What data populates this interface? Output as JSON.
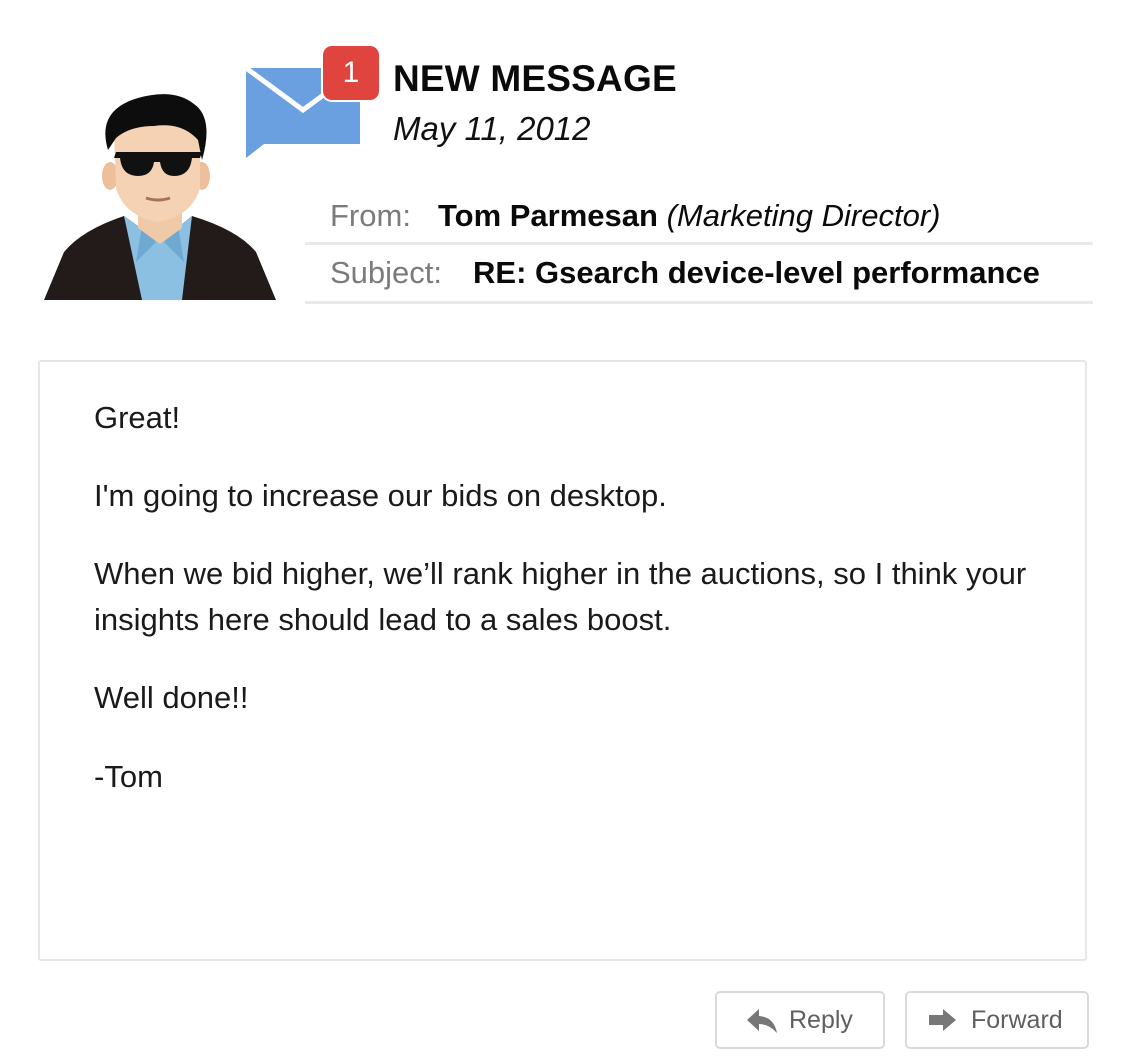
{
  "notification": {
    "badge_count": "1",
    "title": "NEW MESSAGE",
    "date": "May 11, 2012",
    "envelope_color": "#6a9fe0",
    "badge_color": "#e0443e"
  },
  "header": {
    "from_label": "From:",
    "from_name": "Tom Parmesan",
    "from_role": "(Marketing Director)",
    "subject_label": "Subject:",
    "subject_value": "RE: Gsearch device-level performance"
  },
  "message": {
    "paragraphs": [
      "Great!",
      "I'm going to increase our bids on desktop.",
      "When we bid higher, we’ll rank higher in the auctions, so I think your insights here should lead to a sales boost.",
      "Well done!!",
      "-Tom"
    ]
  },
  "actions": {
    "reply_label": "Reply",
    "reply_icon": "reply-arrow-icon",
    "forward_label": "Forward",
    "forward_icon": "forward-arrow-icon"
  }
}
